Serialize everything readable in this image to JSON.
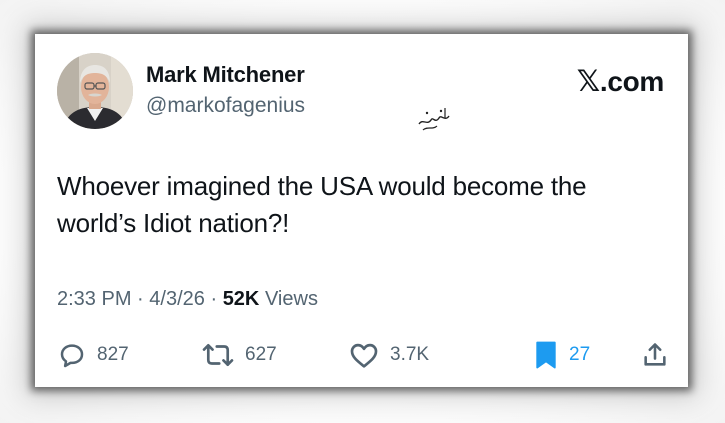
{
  "colors": {
    "text_primary": "#0f1419",
    "text_secondary": "#536471",
    "accent": "#1d9bf0"
  },
  "author": {
    "display_name": "Mark Mitchener",
    "handle": "@markofagenius",
    "avatar_icon": "avatar-photo"
  },
  "brand": {
    "logo_icon": "x-logo-icon",
    "label": ".com"
  },
  "watermark": {
    "text": "جهان‌نما"
  },
  "tweet": {
    "text": "Whoever imagined the USA would become the world’s Idiot nation?!",
    "time": "2:33 PM",
    "separator": "·",
    "date": "4/3/26",
    "views_count": "52K",
    "views_label": "Views"
  },
  "actions": {
    "reply": {
      "icon": "reply-icon",
      "count": "827"
    },
    "repost": {
      "icon": "repost-icon",
      "count": "627"
    },
    "like": {
      "icon": "heart-icon",
      "count": "3.7K"
    },
    "bookmark": {
      "icon": "bookmark-icon",
      "count": "27",
      "active": true
    },
    "share": {
      "icon": "share-icon"
    }
  }
}
